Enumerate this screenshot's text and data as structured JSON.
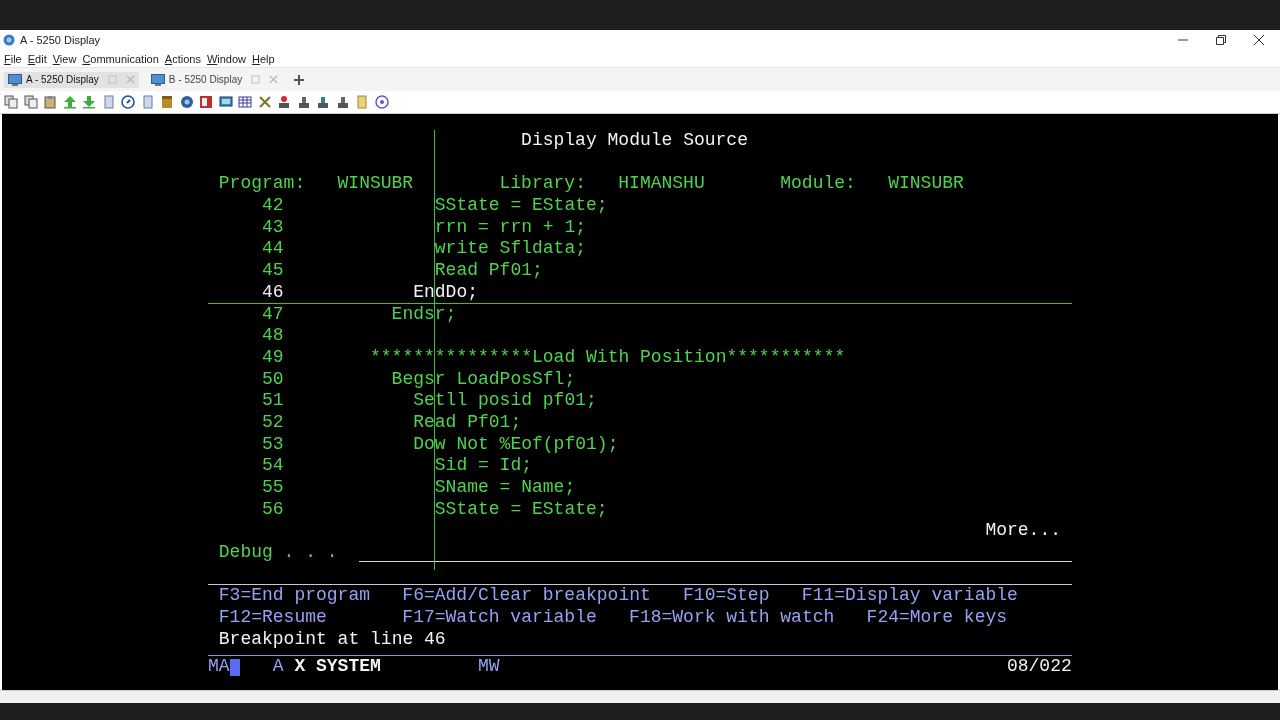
{
  "window": {
    "title": "A - 5250 Display"
  },
  "menu": [
    "File",
    "Edit",
    "View",
    "Communication",
    "Actions",
    "Window",
    "Help"
  ],
  "tabs": [
    {
      "label": "A - 5250 Display",
      "selected": true
    },
    {
      "label": "B - 5250 Display",
      "selected": false
    }
  ],
  "screen": {
    "title": "Display Module Source",
    "header": [
      {
        "label": "Program:",
        "value": "WINSUBR"
      },
      {
        "label": "Library:",
        "value": "HIMANSHU"
      },
      {
        "label": "Module:",
        "value": "WINSUBR"
      }
    ],
    "lines": [
      {
        "number": "42",
        "code": "             SState = EState;",
        "current": false
      },
      {
        "number": "43",
        "code": "             rrn = rrn + 1;",
        "current": false
      },
      {
        "number": "44",
        "code": "             write Sfldata;",
        "current": false
      },
      {
        "number": "45",
        "code": "             Read Pf01;",
        "current": false
      },
      {
        "number": "46",
        "code": "           EndDo;",
        "current": true
      },
      {
        "number": "47",
        "code": "         Endsr;",
        "current": false
      },
      {
        "number": "48",
        "current": false
      },
      {
        "number": "49",
        "code": "       ***************Load With Position***********",
        "current": false
      },
      {
        "number": "50",
        "code": "         Begsr LoadPosSfl;",
        "current": false
      },
      {
        "number": "51",
        "code": "           Setll posid pf01;",
        "current": false
      },
      {
        "number": "52",
        "code": "           Read Pf01;",
        "current": false
      },
      {
        "number": "53",
        "code": "           Dow Not %Eof(pf01);",
        "current": false
      },
      {
        "number": "54",
        "code": "             Sid = Id;",
        "current": false
      },
      {
        "number": "55",
        "code": "             SName = Name;",
        "current": false
      },
      {
        "number": "56",
        "code": "             SState = EState;",
        "current": false
      }
    ],
    "more": "More...",
    "debug_label": "Debug . . .",
    "function_keys": [
      [
        "F3=End program",
        "F6=Add/Clear breakpoint",
        "F10=Step",
        "F11=Display variable"
      ],
      [
        "F12=Resume",
        "F17=Watch variable",
        "F18=Work with watch",
        "F24=More keys"
      ]
    ],
    "message": "Breakpoint at line 46",
    "status": {
      "mode": "MA",
      "indicator": "A",
      "system": "X SYSTEM",
      "workstation": "MW",
      "position": "08/022"
    }
  }
}
